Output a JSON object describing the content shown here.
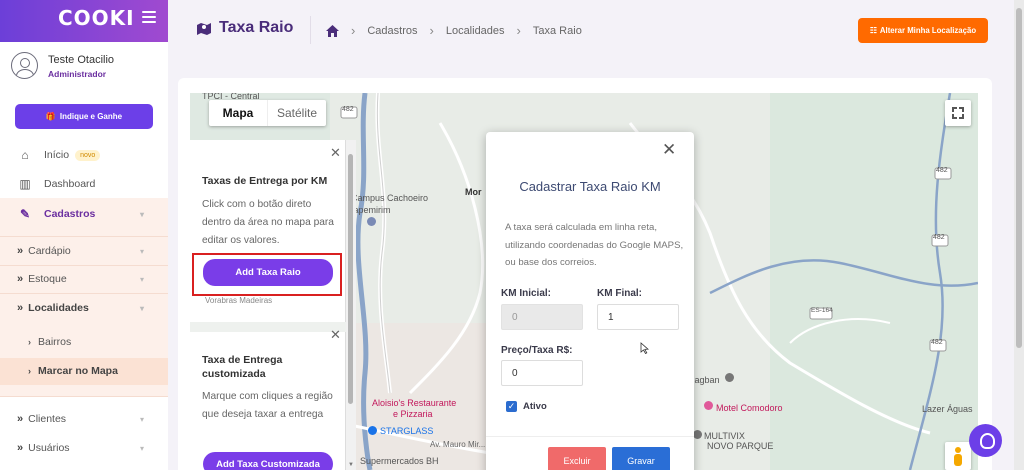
{
  "app": {
    "logo": "COOKI"
  },
  "user": {
    "name": "Teste Otacilio",
    "role": "Administrador"
  },
  "sidebar": {
    "indique_label": "Indique e Ganhe",
    "items": [
      {
        "label": "Início",
        "badge": "novo"
      },
      {
        "label": "Dashboard"
      },
      {
        "label": "Cadastros"
      },
      {
        "label": "Cardápio"
      },
      {
        "label": "Estoque"
      },
      {
        "label": "Localidades"
      },
      {
        "label": "Bairros"
      },
      {
        "label": "Marcar no Mapa"
      },
      {
        "label": "Clientes"
      },
      {
        "label": "Usuários"
      }
    ]
  },
  "header": {
    "title": "Taxa Raio",
    "breadcrumb": [
      "Cadastros",
      "Localidades",
      "Taxa Raio"
    ],
    "change_location_label": "Alterar Minha Localização"
  },
  "map": {
    "toggle": {
      "map": "Mapa",
      "satellite": "Satélite"
    },
    "labels": {
      "campus": "Campus Cachoeiro",
      "itapemirim": "tapemirim",
      "mor": "Mor",
      "aloisio": "Aloisio's Restaurante",
      "pizzaria": "e Pizzaria",
      "starglass": "STARGLASS",
      "supermercados": "Supermercados BH",
      "magban": "Magban",
      "motel": "Motel Comodoro",
      "multivix": "MULTIVIX",
      "novo_parque": "NOVO PARQUE",
      "lazer": "Lazer Águas",
      "madeiras": "Vorabras Madeiras",
      "tpci": "TPCI - Central",
      "rodovia_482": "482",
      "rodovia_es164": "ES-164",
      "av_mauro": "Av. Mauro Mir..."
    }
  },
  "panel": {
    "km_title": "Taxas de Entrega por KM",
    "km_desc": "Click com o botão direto dentro da área no mapa para editar os valores.",
    "km_button": "Add Taxa Raio",
    "custom_title": "Taxa de Entrega customizada",
    "custom_desc": "Marque com cliques a região que deseja taxar a entrega",
    "custom_button": "Add Taxa Customizada"
  },
  "modal": {
    "title": "Cadastrar Taxa Raio KM",
    "description": "A taxa será calculada em linha reta, utilizando coordenadas do Google MAPS, ou base dos correios.",
    "km_initial_label": "KM Inicial:",
    "km_initial_value": "0",
    "km_final_label": "KM Final:",
    "km_final_value": "1",
    "price_label": "Preço/Taxa R$:",
    "price_value": "0",
    "active_label": "Ativo",
    "active_checked": true,
    "delete_label": "Excluir",
    "save_label": "Gravar"
  },
  "colors": {
    "primary": "#6c3fe8",
    "accent": "#ff6a00",
    "highlight": "#d92020",
    "title": "#4a2d7a"
  }
}
